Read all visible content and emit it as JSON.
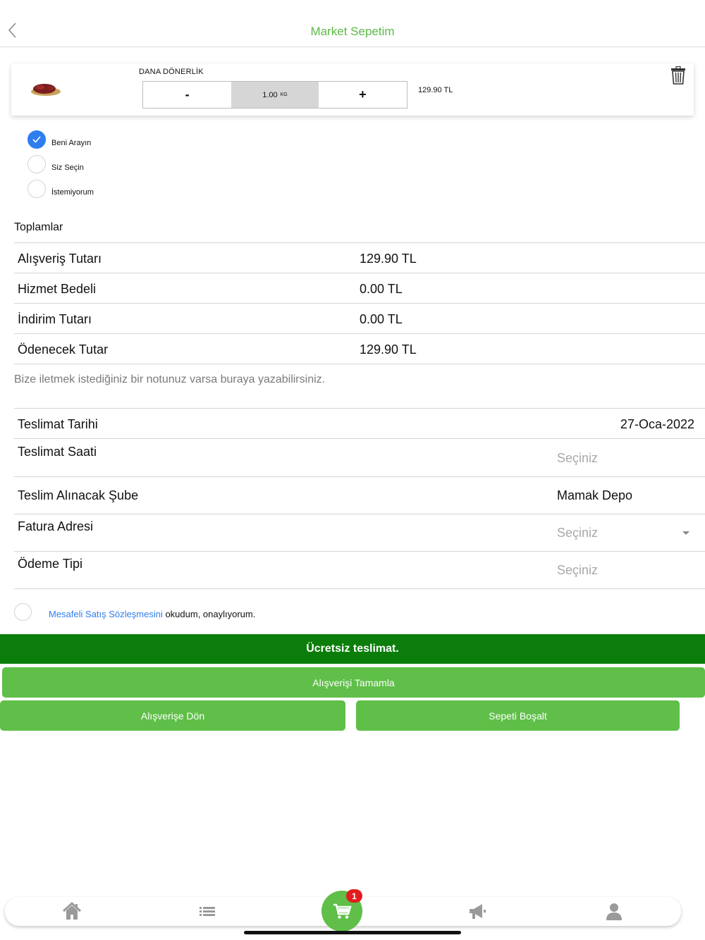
{
  "header": {
    "title": "Market Sepetim",
    "back_icon": "chevron-left-icon"
  },
  "product": {
    "name": "DANA DÖNERLİK",
    "decrement_label": "-",
    "quantity": "1.00",
    "unit": "KG",
    "increment_label": "+",
    "price": "129.90 TL",
    "image_icon": "meat-icon",
    "delete_icon": "trash-icon"
  },
  "contact_options": [
    {
      "label": "Beni Arayın",
      "checked": true
    },
    {
      "label": "Siz Seçin",
      "checked": false
    },
    {
      "label": "İstemiyorum",
      "checked": false
    }
  ],
  "totals": {
    "title": "Toplamlar",
    "rows": [
      {
        "label": "Alışveriş Tutarı",
        "value": "129.90 TL"
      },
      {
        "label": "Hizmet Bedeli",
        "value": "0.00 TL"
      },
      {
        "label": "İndirim Tutarı",
        "value": "0.00 TL"
      },
      {
        "label": "Ödenecek Tutar",
        "value": "129.90 TL"
      }
    ]
  },
  "note": {
    "placeholder": "Bize iletmek istediğiniz bir notunuz varsa buraya yazabilirsiniz."
  },
  "delivery": {
    "date_label": "Teslimat Tarihi",
    "date_value": "27-Oca-2022",
    "time_label": "Teslimat Saati",
    "time_value": "Seçiniz",
    "branch_label": "Teslim Alınacak Şube",
    "branch_value": "Mamak Depo",
    "invoice_label": "Fatura Adresi",
    "invoice_value": "Seçiniz",
    "payment_label": "Ödeme Tipi",
    "payment_value": "Seçiniz"
  },
  "agreement": {
    "link_text": "Mesafeli Satış Sözleşmesini",
    "suffix_text": " okudum, onaylıyorum.",
    "checked": false
  },
  "banner": {
    "text": "Ücretsiz teslimat."
  },
  "buttons": {
    "complete": "Alışverişi Tamamla",
    "back_to_shop": "Alışverişe Dön",
    "empty_cart": "Sepeti Boşalt"
  },
  "tabbar": {
    "items": [
      "home-icon",
      "list-icon",
      "cart-icon",
      "megaphone-icon",
      "user-icon"
    ],
    "cart_badge": "1"
  },
  "colors": {
    "accent": "#5cb946",
    "button": "#5fbf48",
    "banner": "#0a7d0a",
    "checked": "#2f7ef0",
    "badge": "#e01e1e"
  }
}
